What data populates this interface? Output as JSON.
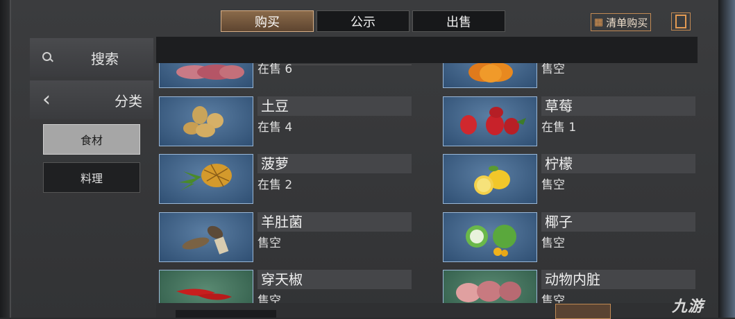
{
  "tabs": [
    {
      "label": "购买",
      "active": true
    },
    {
      "label": "公示",
      "active": false
    },
    {
      "label": "出售",
      "active": false
    }
  ],
  "header": {
    "list_buy_label": "清单购买",
    "list_buy_icon": "hierarchy-icon",
    "clipboard_icon": "clipboard-icon"
  },
  "sidebar": {
    "search_label": "搜索",
    "category_label": "分类",
    "sub_items": [
      {
        "label": "食材",
        "selected": true
      },
      {
        "label": "料理",
        "selected": false
      }
    ]
  },
  "items": [
    {
      "name": "",
      "status": "在售 6",
      "art": "meat"
    },
    {
      "name": "",
      "status": "售空",
      "art": "pumpkin"
    },
    {
      "name": "土豆",
      "status": "在售 4",
      "art": "potato"
    },
    {
      "name": "草莓",
      "status": "在售 1",
      "art": "strawberry"
    },
    {
      "name": "菠萝",
      "status": "在售 2",
      "art": "pineapple"
    },
    {
      "name": "柠檬",
      "status": "售空",
      "art": "lemon"
    },
    {
      "name": "羊肚菌",
      "status": "售空",
      "art": "morel"
    },
    {
      "name": "椰子",
      "status": "售空",
      "art": "coconut"
    },
    {
      "name": "穿天椒",
      "status": "售空",
      "art": "chili"
    },
    {
      "name": "动物内脏",
      "status": "售空",
      "art": "offal"
    }
  ],
  "watermark": "九游"
}
